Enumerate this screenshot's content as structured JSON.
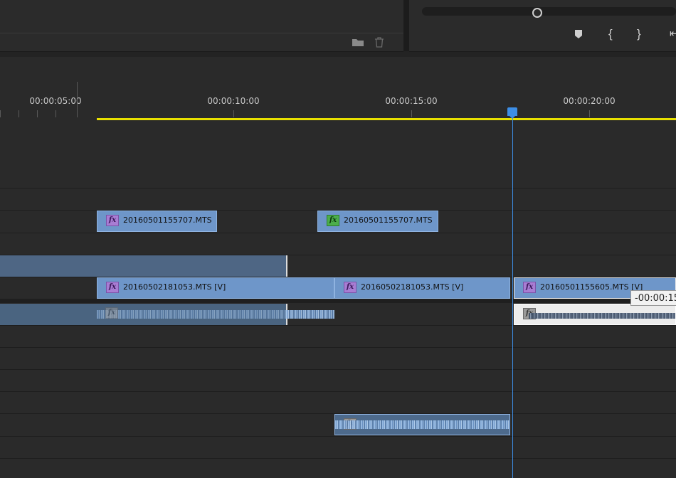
{
  "ruler": {
    "labels": [
      "00:00:05:00",
      "00:00:10:00",
      "00:00:15:00",
      "00:00:20:00"
    ]
  },
  "clips": {
    "v2_a": "20160501155707.MTS",
    "v2_b": "20160501155707.MTS",
    "v1_a": "20160502181053.MTS [V]",
    "v1_b": "20160502181053.MTS [V]",
    "v1_c": "20160501155605.MTS [V]",
    "fx_label": "fx"
  },
  "tooltip": {
    "text": "-00:00:15"
  },
  "icons": {
    "folder": "folder-icon",
    "trash": "trash-icon",
    "marker": "marker-icon",
    "mark_in": "mark-in-icon",
    "mark_out": "mark-out-icon"
  },
  "colors": {
    "playhead": "#3d8ee6",
    "work_area": "#e8e000",
    "clip": "#6e96c9"
  }
}
